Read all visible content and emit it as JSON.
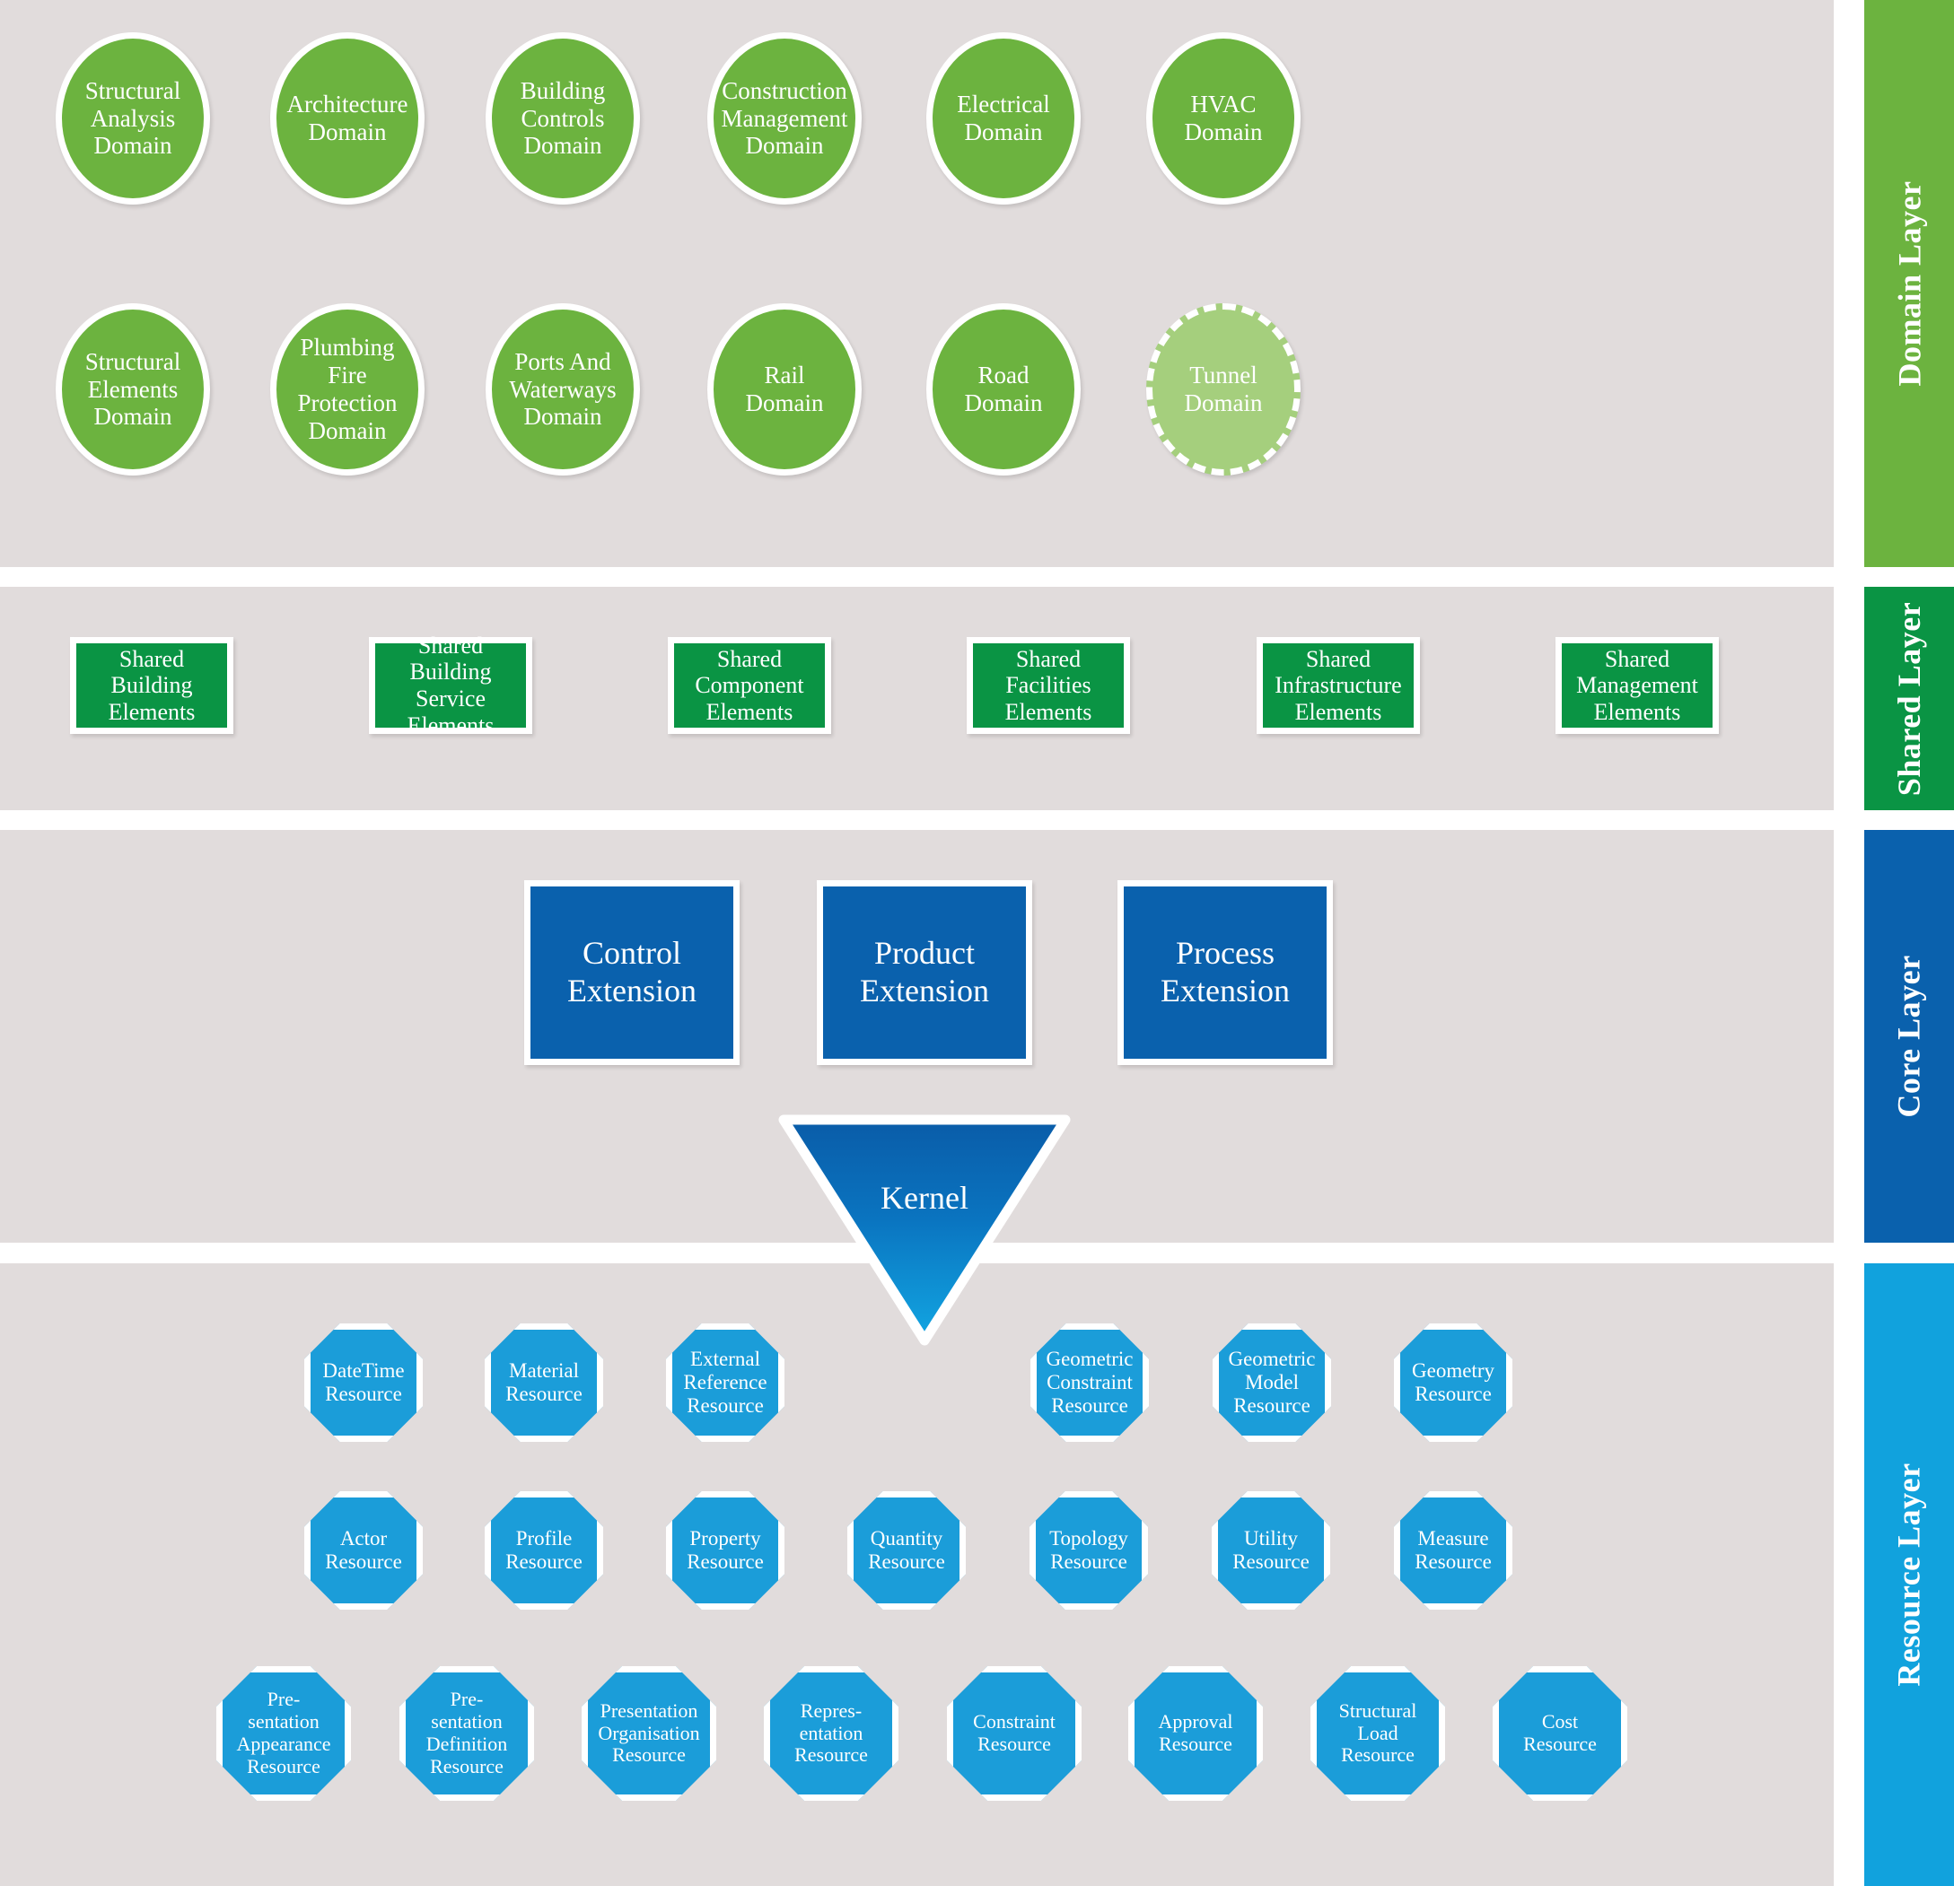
{
  "layers": [
    {
      "id": "domain",
      "label": "Domain Layer",
      "color": "#6cb33f"
    },
    {
      "id": "shared",
      "label": "Shared Layer",
      "color": "#0a9444"
    },
    {
      "id": "core",
      "label": "Core Layer",
      "color": "#0a61ad"
    },
    {
      "id": "resource",
      "label": "Resource Layer",
      "color": "#11a2dd"
    }
  ],
  "panel_background": "#e1dcdc",
  "domain": {
    "row1": [
      {
        "label": "Structural\nAnalysis\nDomain",
        "dashed": false
      },
      {
        "label": "Architecture\nDomain",
        "dashed": false
      },
      {
        "label": "Building\nControls\nDomain",
        "dashed": false
      },
      {
        "label": "Construction\nManagement\nDomain",
        "dashed": false
      },
      {
        "label": "Electrical\nDomain",
        "dashed": false
      },
      {
        "label": "HVAC\nDomain",
        "dashed": false
      }
    ],
    "row2": [
      {
        "label": "Structural\nElements\nDomain",
        "dashed": false
      },
      {
        "label": "Plumbing\nFire Protection\nDomain",
        "dashed": false
      },
      {
        "label": "Ports And\nWaterways\nDomain",
        "dashed": false
      },
      {
        "label": "Rail\nDomain",
        "dashed": false
      },
      {
        "label": "Road\nDomain",
        "dashed": false
      },
      {
        "label": "Tunnel\nDomain",
        "dashed": true
      }
    ]
  },
  "shared": {
    "items": [
      {
        "label": "Shared\nBuilding\nElements"
      },
      {
        "label": "Shared\nBuilding Service\nElements"
      },
      {
        "label": "Shared\nComponent\nElements"
      },
      {
        "label": "Shared\nFacilities\nElements"
      },
      {
        "label": "Shared\nInfrastructure\nElements"
      },
      {
        "label": "Shared\nManagement\nElements"
      }
    ]
  },
  "core": {
    "extensions": [
      {
        "label": "Control\nExtension"
      },
      {
        "label": "Product\nExtension"
      },
      {
        "label": "Process\nExtension"
      }
    ],
    "kernel": {
      "label": "Kernel",
      "gradient_from": "#0a5ca8",
      "gradient_to": "#11a2dd"
    }
  },
  "resource": {
    "row1": [
      {
        "label": "DateTime\nResource"
      },
      {
        "label": "Material\nResource"
      },
      {
        "label": "External\nReference\nResource"
      },
      {
        "label": "Geometric\nConstraint\nResource"
      },
      {
        "label": "Geometric\nModel\nResource"
      },
      {
        "label": "Geometry\nResource"
      }
    ],
    "row2": [
      {
        "label": "Actor\nResource"
      },
      {
        "label": "Profile\nResource"
      },
      {
        "label": "Property\nResource"
      },
      {
        "label": "Quantity\nResource"
      },
      {
        "label": "Topology\nResource"
      },
      {
        "label": "Utility\nResource"
      },
      {
        "label": "Measure\nResource"
      }
    ],
    "row3": [
      {
        "label": "Pre-\nsentation\nAppearance\nResource"
      },
      {
        "label": "Pre-\nsentation\nDefinition\nResource"
      },
      {
        "label": "Presentation\nOrganisation\nResource"
      },
      {
        "label": "Repres-\nentation\nResource"
      },
      {
        "label": "Constraint\nResource"
      },
      {
        "label": "Approval\nResource"
      },
      {
        "label": "Structural\nLoad\nResource"
      },
      {
        "label": "Cost\nResource"
      }
    ]
  }
}
